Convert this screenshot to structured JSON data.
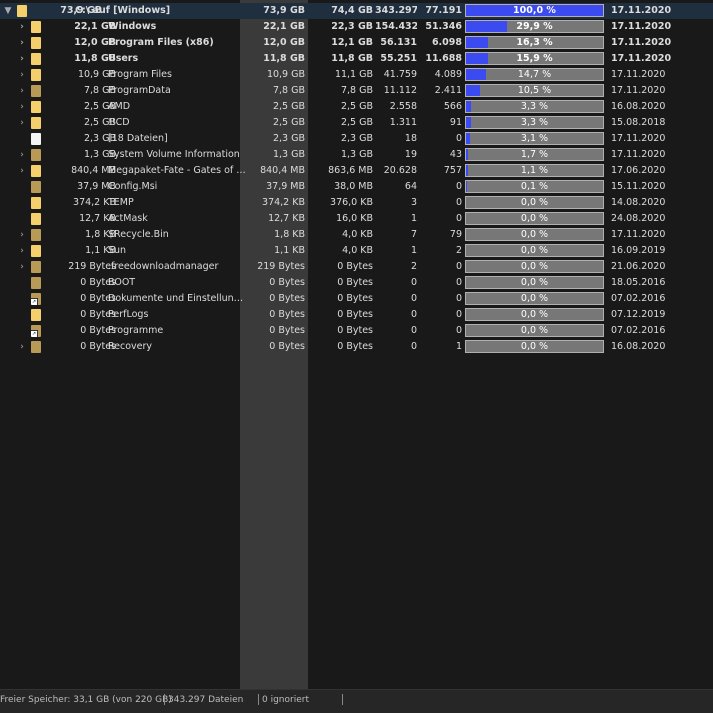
{
  "rows": [
    {
      "level": 0,
      "arrow": "▼",
      "icon": "folder",
      "size": "73,9 GB",
      "name": "C:\\  auf  [Windows]",
      "alloc": "73,9 GB",
      "disk": "74,4 GB",
      "files": "343.297",
      "dirs": "77.191",
      "pct": "100,0 %",
      "fill": 1.0,
      "date": "17.11.2020",
      "bold": true,
      "root": true
    },
    {
      "level": 1,
      "arrow": "›",
      "icon": "folder",
      "size": "22,1 GB",
      "name": "Windows",
      "alloc": "22,1 GB",
      "disk": "22,3 GB",
      "files": "154.432",
      "dirs": "51.346",
      "pct": "29,9 %",
      "fill": 0.299,
      "date": "17.11.2020",
      "bold": true
    },
    {
      "level": 1,
      "arrow": "›",
      "icon": "folder",
      "size": "12,0 GB",
      "name": "Program Files (x86)",
      "alloc": "12,0 GB",
      "disk": "12,1 GB",
      "files": "56.131",
      "dirs": "6.098",
      "pct": "16,3 %",
      "fill": 0.163,
      "date": "17.11.2020",
      "bold": true
    },
    {
      "level": 1,
      "arrow": "›",
      "icon": "folder",
      "size": "11,8 GB",
      "name": "Users",
      "alloc": "11,8 GB",
      "disk": "11,8 GB",
      "files": "55.251",
      "dirs": "11.688",
      "pct": "15,9 %",
      "fill": 0.159,
      "date": "17.11.2020",
      "bold": true
    },
    {
      "level": 1,
      "arrow": "›",
      "icon": "folder",
      "size": "10,9 GB",
      "name": "Program Files",
      "alloc": "10,9 GB",
      "disk": "11,1 GB",
      "files": "41.759",
      "dirs": "4.089",
      "pct": "14,7 %",
      "fill": 0.147,
      "date": "17.11.2020"
    },
    {
      "level": 1,
      "arrow": "›",
      "icon": "folder-dark",
      "size": "7,8 GB",
      "name": "ProgramData",
      "alloc": "7,8 GB",
      "disk": "7,8 GB",
      "files": "11.112",
      "dirs": "2.411",
      "pct": "10,5 %",
      "fill": 0.105,
      "date": "17.11.2020"
    },
    {
      "level": 1,
      "arrow": "›",
      "icon": "folder",
      "size": "2,5 GB",
      "name": "AMD",
      "alloc": "2,5 GB",
      "disk": "2,5 GB",
      "files": "2.558",
      "dirs": "566",
      "pct": "3,3 %",
      "fill": 0.033,
      "date": "16.08.2020"
    },
    {
      "level": 1,
      "arrow": "›",
      "icon": "folder",
      "size": "2,5 GB",
      "name": "!!CD",
      "alloc": "2,5 GB",
      "disk": "2,5 GB",
      "files": "1.311",
      "dirs": "91",
      "pct": "3,3 %",
      "fill": 0.033,
      "date": "15.08.2018"
    },
    {
      "level": 1,
      "arrow": "",
      "icon": "file",
      "size": "2,3 GB",
      "name": "[18 Dateien]",
      "alloc": "2,3 GB",
      "disk": "2,3 GB",
      "files": "18",
      "dirs": "0",
      "pct": "3,1 %",
      "fill": 0.031,
      "date": "17.11.2020"
    },
    {
      "level": 1,
      "arrow": "›",
      "icon": "folder-dark",
      "size": "1,3 GB",
      "name": "System Volume Information",
      "alloc": "1,3 GB",
      "disk": "1,3 GB",
      "files": "19",
      "dirs": "43",
      "pct": "1,7 %",
      "fill": 0.017,
      "date": "17.11.2020"
    },
    {
      "level": 1,
      "arrow": "›",
      "icon": "folder",
      "size": "840,4 MB",
      "name": "Megapaket-Fate - Gates of D...",
      "alloc": "840,4 MB",
      "disk": "863,6 MB",
      "files": "20.628",
      "dirs": "757",
      "pct": "1,1 %",
      "fill": 0.011,
      "date": "17.06.2020"
    },
    {
      "level": 1,
      "arrow": "",
      "icon": "folder-dark",
      "size": "37,9 MB",
      "name": "Config.Msi",
      "alloc": "37,9 MB",
      "disk": "38,0 MB",
      "files": "64",
      "dirs": "0",
      "pct": "0,1 %",
      "fill": 0.001,
      "date": "15.11.2020"
    },
    {
      "level": 1,
      "arrow": "",
      "icon": "folder",
      "size": "374,2 KB",
      "name": "TEMP",
      "alloc": "374,2 KB",
      "disk": "376,0 KB",
      "files": "3",
      "dirs": "0",
      "pct": "0,0 %",
      "fill": 0,
      "date": "14.08.2020"
    },
    {
      "level": 1,
      "arrow": "",
      "icon": "folder",
      "size": "12,7 KB",
      "name": "ActMask",
      "alloc": "12,7 KB",
      "disk": "16,0 KB",
      "files": "1",
      "dirs": "0",
      "pct": "0,0 %",
      "fill": 0,
      "date": "24.08.2020"
    },
    {
      "level": 1,
      "arrow": "›",
      "icon": "folder-dark",
      "size": "1,8 KB",
      "name": "$Recycle.Bin",
      "alloc": "1,8 KB",
      "disk": "4,0 KB",
      "files": "7",
      "dirs": "79",
      "pct": "0,0 %",
      "fill": 0,
      "date": "17.11.2020"
    },
    {
      "level": 1,
      "arrow": "›",
      "icon": "folder",
      "size": "1,1 KB",
      "name": "Sun",
      "alloc": "1,1 KB",
      "disk": "4,0 KB",
      "files": "1",
      "dirs": "2",
      "pct": "0,0 %",
      "fill": 0,
      "date": "16.09.2019"
    },
    {
      "level": 1,
      "arrow": "›",
      "icon": "folder-dark",
      "size": "219 Bytes",
      "name": ".freedownloadmanager",
      "alloc": "219 Bytes",
      "disk": "0 Bytes",
      "files": "2",
      "dirs": "0",
      "pct": "0,0 %",
      "fill": 0,
      "date": "21.06.2020"
    },
    {
      "level": 1,
      "arrow": "",
      "icon": "folder-dark",
      "size": "0 Bytes",
      "name": "BOOT",
      "alloc": "0 Bytes",
      "disk": "0 Bytes",
      "files": "0",
      "dirs": "0",
      "pct": "0,0 %",
      "fill": 0,
      "date": "18.05.2016"
    },
    {
      "level": 1,
      "arrow": "",
      "icon": "folder-dark-link",
      "size": "0 Bytes",
      "name": "Dokumente und Einstellungen",
      "alloc": "0 Bytes",
      "disk": "0 Bytes",
      "files": "0",
      "dirs": "0",
      "pct": "0,0 %",
      "fill": 0,
      "date": "07.02.2016"
    },
    {
      "level": 1,
      "arrow": "",
      "icon": "folder",
      "size": "0 Bytes",
      "name": "PerfLogs",
      "alloc": "0 Bytes",
      "disk": "0 Bytes",
      "files": "0",
      "dirs": "0",
      "pct": "0,0 %",
      "fill": 0,
      "date": "07.12.2019"
    },
    {
      "level": 1,
      "arrow": "",
      "icon": "folder-dark-link",
      "size": "0 Bytes",
      "name": "Programme",
      "alloc": "0 Bytes",
      "disk": "0 Bytes",
      "files": "0",
      "dirs": "0",
      "pct": "0,0 %",
      "fill": 0,
      "date": "07.02.2016"
    },
    {
      "level": 1,
      "arrow": "›",
      "icon": "folder-dark",
      "size": "0 Bytes",
      "name": "Recovery",
      "alloc": "0 Bytes",
      "disk": "0 Bytes",
      "files": "0",
      "dirs": "1",
      "pct": "0,0 %",
      "fill": 0,
      "date": "16.08.2020"
    }
  ],
  "status": {
    "free_space": "Freier Speicher: 33,1 GB  (von 220 GB)",
    "files": "343.297 Dateien",
    "ignored": "0 ignoriert"
  }
}
